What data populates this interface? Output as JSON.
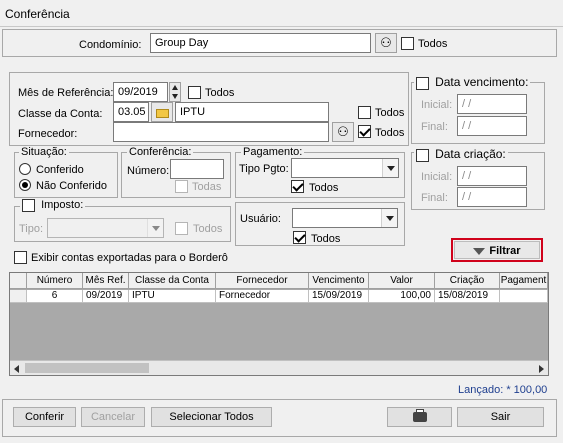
{
  "window": {
    "title": "Conferência"
  },
  "condominio": {
    "label": "Condomínio:",
    "value": "Group Day",
    "todos_label": "Todos"
  },
  "mes_ref": {
    "label": "Mês de Referência:",
    "value": "09/2019",
    "todos_label": "Todos"
  },
  "classe": {
    "label": "Classe da Conta:",
    "code": "03.05",
    "name": "IPTU",
    "todos_label": "Todos"
  },
  "fornecedor": {
    "label": "Fornecedor:",
    "value": "",
    "todos_label": "Todos"
  },
  "data_venc": {
    "title": "Data vencimento:",
    "inicial_label": "Inicial:",
    "inicial_value": " / /",
    "final_label": "Final:",
    "final_value": " / /"
  },
  "data_criacao": {
    "title": "Data criação:",
    "inicial_label": "Inicial:",
    "inicial_value": " / /",
    "final_label": "Final:",
    "final_value": " / /"
  },
  "situacao": {
    "title": "Situação:",
    "opt1": "Conferido",
    "opt2": "Não Conferido",
    "selected": "Não Conferido"
  },
  "conferencia": {
    "title": "Conferência:",
    "numero_label": "Número:",
    "numero_value": "",
    "todos_label": "Todas"
  },
  "pagamento": {
    "title": "Pagamento:",
    "tipo_label": "Tipo Pgto:",
    "tipo_value": "",
    "todos_label": "Todos"
  },
  "imposto": {
    "title": "Imposto:",
    "tipo_label": "Tipo:",
    "tipo_value": "",
    "todos_label": "Todos"
  },
  "usuario": {
    "label": "Usuário:",
    "value": "",
    "todos_label": "Todos"
  },
  "exibir_label": "Exibir contas exportadas para o Borderô",
  "filtrar_label": "Filtrar",
  "table": {
    "headers": [
      "Número",
      "Mês Ref.",
      "Classe da Conta",
      "Fornecedor",
      "Vencimento",
      "Valor",
      "Criação",
      "Pagament"
    ],
    "rows": [
      [
        "6",
        "09/2019",
        "IPTU",
        "Fornecedor",
        "15/09/2019",
        "100,00",
        "15/08/2019",
        ""
      ]
    ]
  },
  "lancado": "Lançado: * 100,00",
  "buttons": {
    "conferir": "Conferir",
    "cancelar": "Cancelar",
    "selecionar": "Selecionar Todos",
    "sair": "Sair"
  },
  "colors": {
    "highlight_border": "#d0021b",
    "grid_bg": "#a9a9a9",
    "lancado_text": "#1f3f8f"
  }
}
